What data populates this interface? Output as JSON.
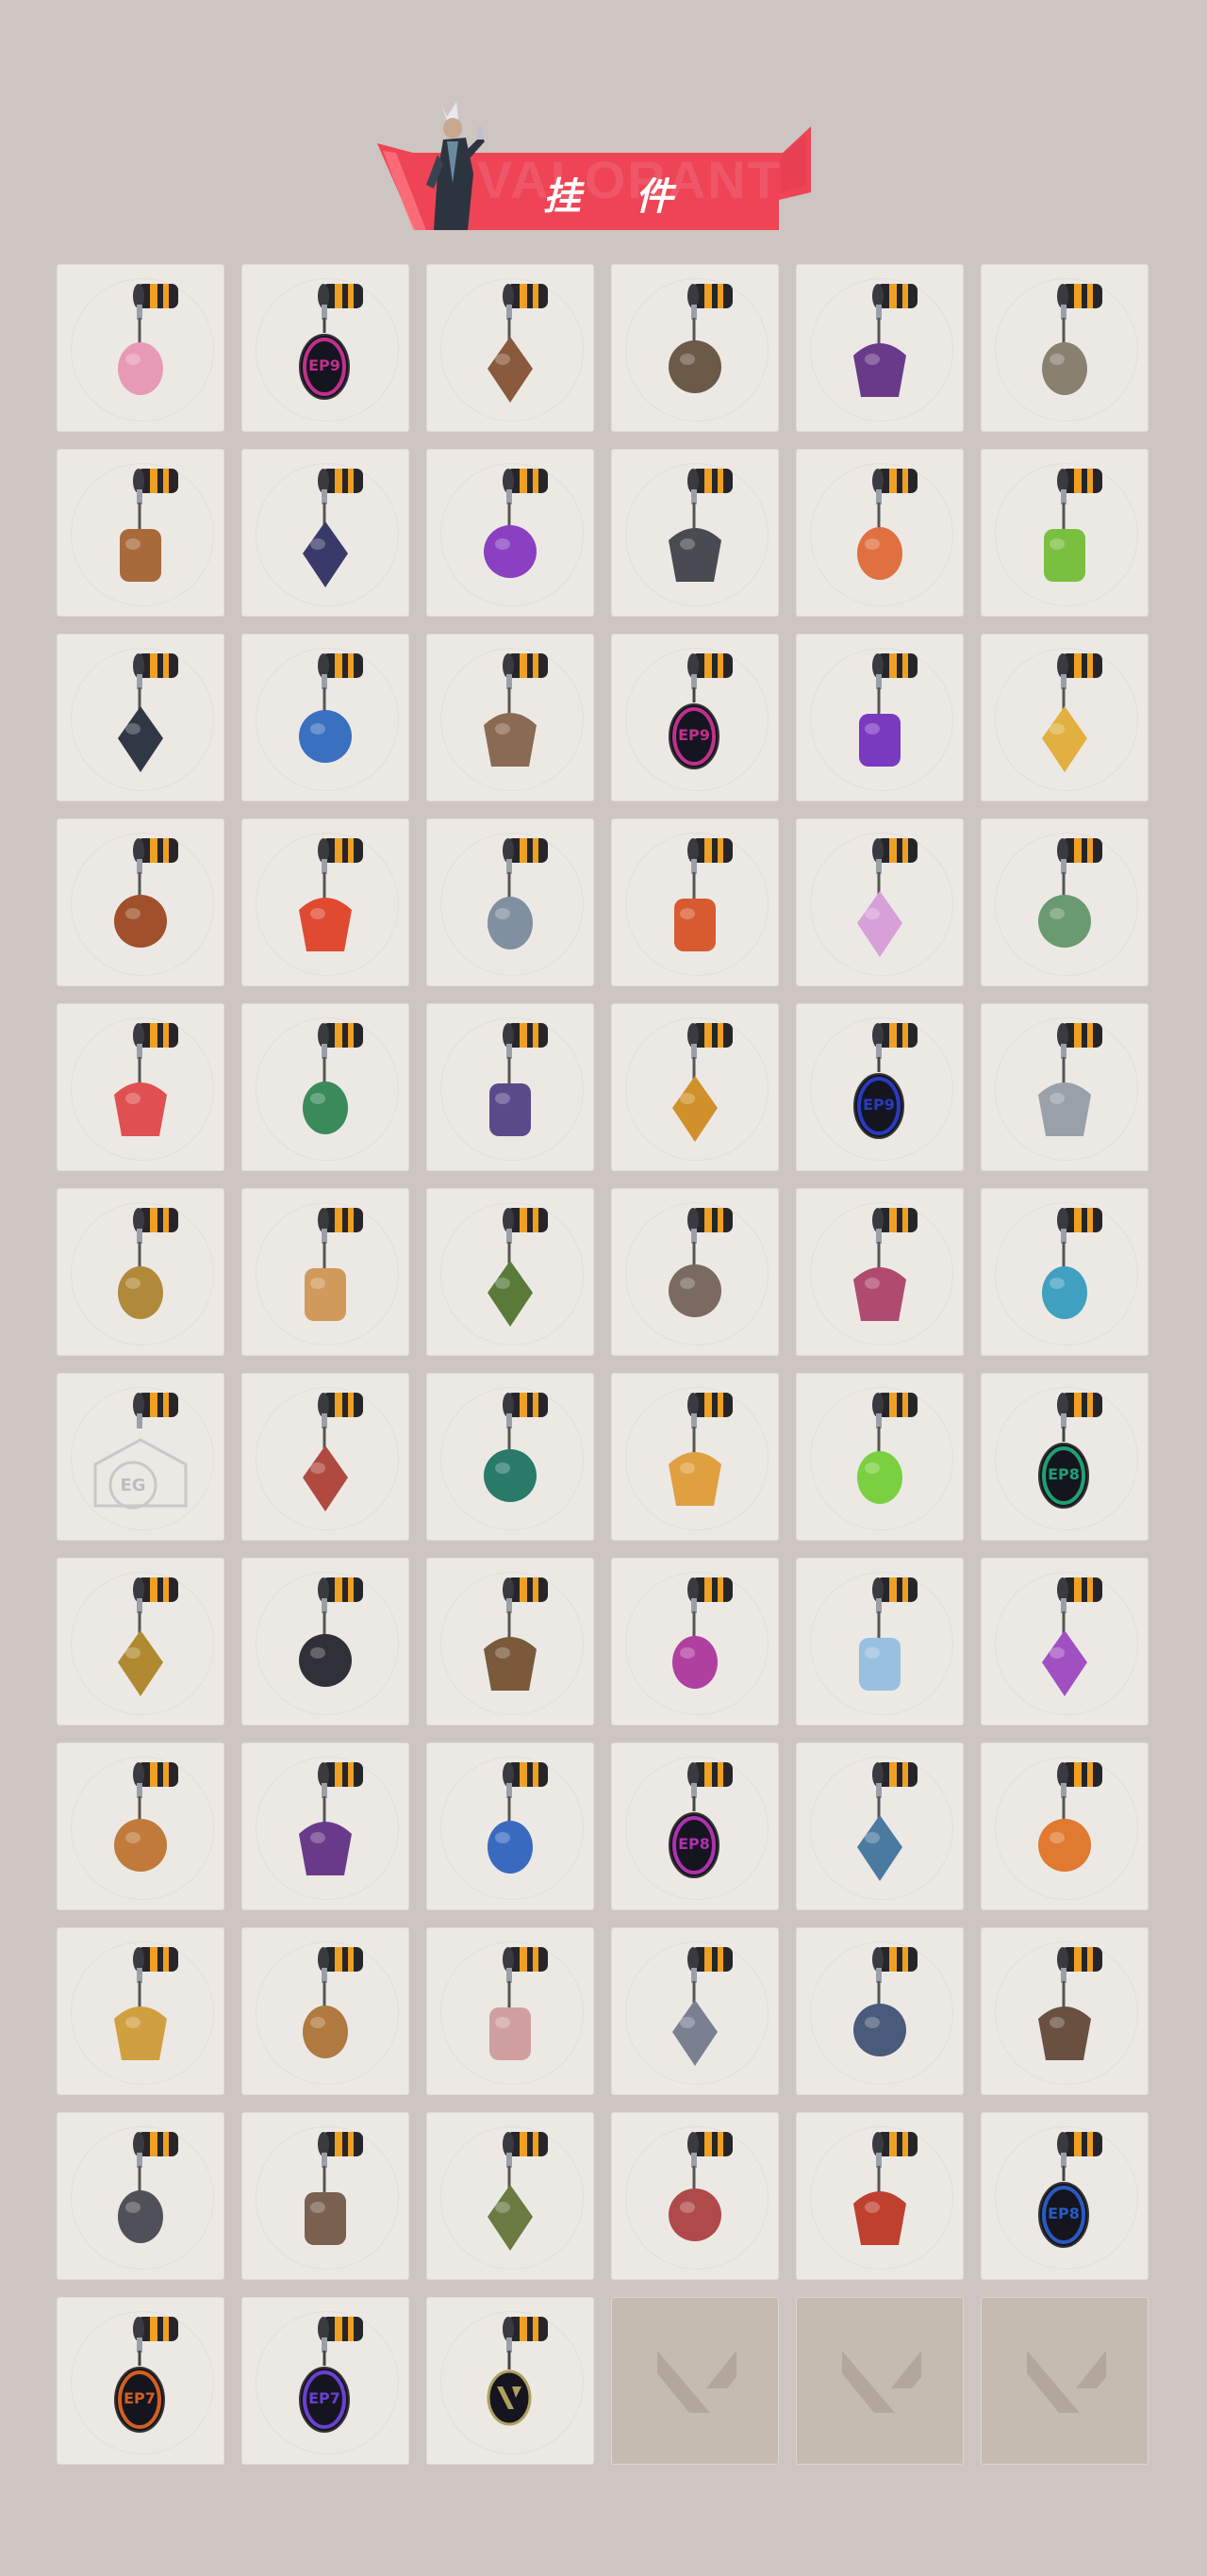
{
  "header": {
    "title": "挂 件",
    "logo_text": "VALORANT",
    "accent_color": "#ee4455"
  },
  "grid": {
    "columns": 6,
    "rows": 12,
    "items": [
      {
        "icon": "cupcake-charm-icon",
        "color": "#e79ab6"
      },
      {
        "icon": "ep9-charm-icon",
        "color": "#c0308c",
        "badge": "EP9"
      },
      {
        "icon": "teddy-bear-bell-charm-icon",
        "color": "#8a5a3c"
      },
      {
        "icon": "gun-charm-icon",
        "color": "#6b5a48"
      },
      {
        "icon": "agent-figure-charm-icon",
        "color": "#6a3a8a"
      },
      {
        "icon": "cowboy-figure-charm-icon",
        "color": "#8a8070"
      },
      {
        "icon": "crate-charm-icon",
        "color": "#a86a3a"
      },
      {
        "icon": "tassel-bird-charm-icon",
        "color": "#3a3a6a"
      },
      {
        "icon": "crystal-charm-icon",
        "color": "#8a40c0"
      },
      {
        "icon": "dragon-charm-icon",
        "color": "#4a4a52"
      },
      {
        "icon": "lava-lamp-charm-icon",
        "color": "#e07040"
      },
      {
        "icon": "pager-charm-icon",
        "color": "#7ac040"
      },
      {
        "icon": "sneaker-charm-icon",
        "color": "#303845"
      },
      {
        "icon": "robot-astronaut-charm-icon",
        "color": "#3a70c0"
      },
      {
        "icon": "radio-charm-icon",
        "color": "#8a6a52"
      },
      {
        "icon": "ep9-charm-icon",
        "color": "#c0308c",
        "badge": "EP9"
      },
      {
        "icon": "pixel-heart-charm-icon",
        "color": "#7a3ac0"
      },
      {
        "icon": "cheese-slice-charm-icon",
        "color": "#e2b040"
      },
      {
        "icon": "popsicle-charm-icon",
        "color": "#a0502a"
      },
      {
        "icon": "candied-fruit-charm-icon",
        "color": "#e04a30"
      },
      {
        "icon": "chibi-agent-charm-icon",
        "color": "#8090a0"
      },
      {
        "icon": "hot-air-balloon-charm-icon",
        "color": "#d85a30"
      },
      {
        "icon": "anime-girl-charm-icon",
        "color": "#d8a0d8"
      },
      {
        "icon": "robot-box-charm-icon",
        "color": "#6a9a70"
      },
      {
        "icon": "watermelon-charm-icon",
        "color": "#e05050"
      },
      {
        "icon": "soda-can-charm-icon",
        "color": "#3a8a5a"
      },
      {
        "icon": "lantern-box-charm-icon",
        "color": "#5a4a8a"
      },
      {
        "icon": "beehive-charm-icon",
        "color": "#d0902a"
      },
      {
        "icon": "ep9-charm-icon",
        "color": "#2a3ac0",
        "badge": "EP9"
      },
      {
        "icon": "swirl-charm-icon",
        "color": "#9aa0a8"
      },
      {
        "icon": "golden-robot-charm-icon",
        "color": "#b08a3a"
      },
      {
        "icon": "fox-charm-icon",
        "color": "#d09a5a"
      },
      {
        "icon": "frog-charm-icon",
        "color": "#5a7a3a"
      },
      {
        "icon": "raccoon-charm-icon",
        "color": "#7a6a60"
      },
      {
        "icon": "mech-figure-charm-icon",
        "color": "#b04a70"
      },
      {
        "icon": "blade-charm-icon",
        "color": "#40a0c0"
      },
      {
        "icon": "event-logo-charm-icon",
        "color": "#c0c0c0"
      },
      {
        "icon": "octopus-charm-icon",
        "color": "#b04a40"
      },
      {
        "icon": "diamond-gem-charm-icon",
        "color": "#2a7a6a"
      },
      {
        "icon": "sun-cloud-charm-icon",
        "color": "#e0a040"
      },
      {
        "icon": "green-lantern-charm-icon",
        "color": "#7ad040"
      },
      {
        "icon": "ep8-charm-icon",
        "color": "#20a070",
        "badge": "EP8"
      },
      {
        "icon": "pretzel-knot-charm-icon",
        "color": "#b08a30"
      },
      {
        "icon": "penguin-claw-charm-icon",
        "color": "#303038"
      },
      {
        "icon": "bottle-charm-icon",
        "color": "#7a5a3a"
      },
      {
        "icon": "jetski-charm-icon",
        "color": "#b040a0"
      },
      {
        "icon": "ufo-jellyfish-charm-icon",
        "color": "#9ac0e0"
      },
      {
        "icon": "flower-flame-charm-icon",
        "color": "#a050c0"
      },
      {
        "icon": "pretzel-charm-icon",
        "color": "#c07a3a"
      },
      {
        "icon": "purple-eye-charm-icon",
        "color": "#6a3a8a"
      },
      {
        "icon": "manta-ray-charm-icon",
        "color": "#3a6ac0"
      },
      {
        "icon": "ep8-charm-icon",
        "color": "#b030b0",
        "badge": "EP8"
      },
      {
        "icon": "ufo-charm-icon",
        "color": "#4a7aa0"
      },
      {
        "icon": "tiger-charm-icon",
        "color": "#e07a30"
      },
      {
        "icon": "egg-pan-charm-icon",
        "color": "#d0a040"
      },
      {
        "icon": "bear-basket-charm-icon",
        "color": "#b07a40"
      },
      {
        "icon": "koi-charm-icon",
        "color": "#d0a0a0"
      },
      {
        "icon": "cat-plush-charm-icon",
        "color": "#7a8090"
      },
      {
        "icon": "rifle-charm-icon",
        "color": "#4a5a7a"
      },
      {
        "icon": "bear-plush-charm-icon",
        "color": "#6a5040"
      },
      {
        "icon": "frying-pan-charm-icon",
        "color": "#505058"
      },
      {
        "icon": "gadget-charm-icon",
        "color": "#7a6050"
      },
      {
        "icon": "plant-charm-icon",
        "color": "#6a7a40"
      },
      {
        "icon": "beetle-charm-icon",
        "color": "#b04a4a"
      },
      {
        "icon": "guitar-charm-icon",
        "color": "#c04030"
      },
      {
        "icon": "ep8-charm-icon",
        "color": "#2a5ac0",
        "badge": "EP8"
      },
      {
        "icon": "ep7-charm-icon",
        "color": "#d06020",
        "badge": "EP7"
      },
      {
        "icon": "ep7-charm-icon",
        "color": "#6a40d0",
        "badge": "EP7"
      },
      {
        "icon": "valorant-v-charm-icon",
        "color": "#b0a060"
      },
      {
        "icon": "empty-slot-icon",
        "empty": true
      },
      {
        "icon": "empty-slot-icon",
        "empty": true
      },
      {
        "icon": "empty-slot-icon",
        "empty": true
      }
    ]
  }
}
